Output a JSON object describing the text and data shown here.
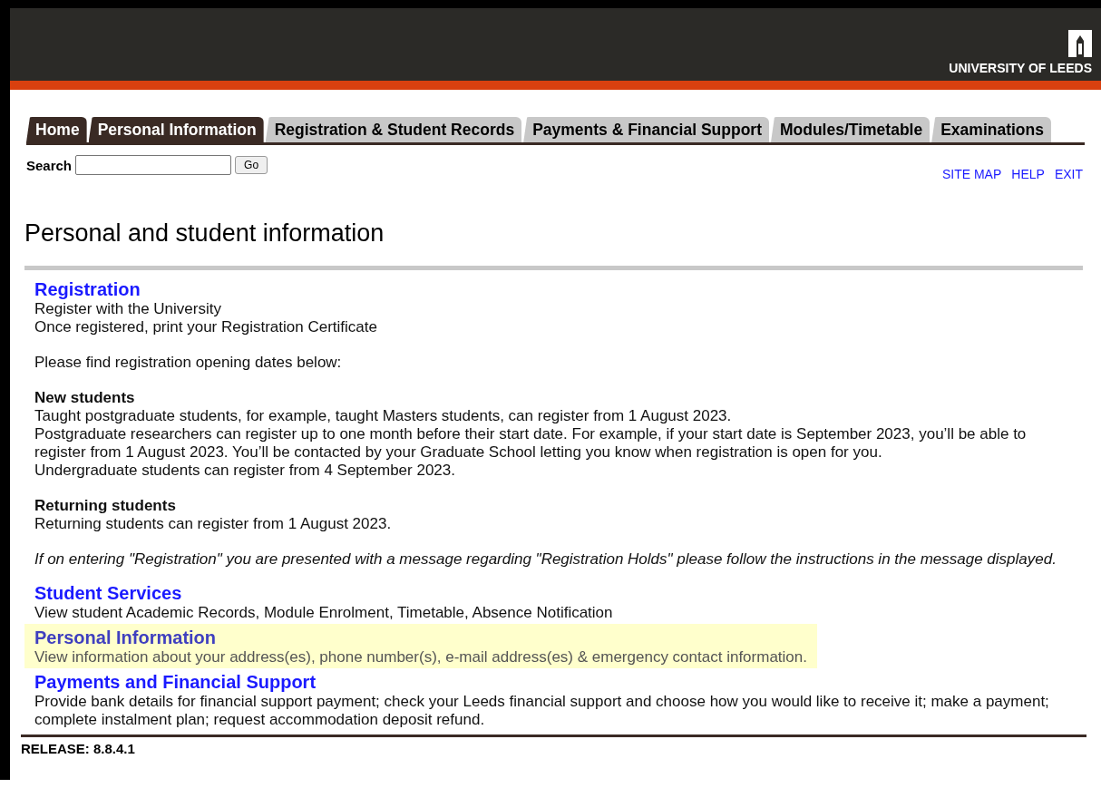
{
  "header": {
    "logo_text": "UNIVERSITY OF LEEDS"
  },
  "tabs": [
    {
      "label": "Home",
      "selected": true
    },
    {
      "label": "Personal Information",
      "selected": true
    },
    {
      "label": "Registration & Student Records",
      "selected": false
    },
    {
      "label": "Payments & Financial Support",
      "selected": false
    },
    {
      "label": "Modules/Timetable",
      "selected": false
    },
    {
      "label": "Examinations",
      "selected": false
    }
  ],
  "search": {
    "label": "Search",
    "button": "Go"
  },
  "top_links": [
    "SITE MAP",
    "HELP",
    "EXIT"
  ],
  "page_title": "Personal and student information",
  "sections": [
    {
      "title": "Registration",
      "highlighted": false,
      "blocks": [
        {
          "kind": "lines",
          "lines": [
            "Register with the University",
            "Once registered, print your Registration Certificate"
          ]
        },
        {
          "kind": "lines",
          "lines": [
            "Please find registration opening dates below:"
          ]
        },
        {
          "kind": "heading",
          "lines": [
            "New students"
          ]
        },
        {
          "kind": "lines",
          "lines": [
            "Taught postgraduate students, for example, taught Masters students, can register from 1 August 2023.",
            "Postgraduate researchers can register up to one month before their start date. For example, if your start date is September 2023, you’ll be able to register from 1 August 2023. You’ll be contacted by your Graduate School letting you know when registration is open for you.",
            "Undergraduate students can register from 4 September 2023."
          ]
        },
        {
          "kind": "heading",
          "lines": [
            "Returning students"
          ]
        },
        {
          "kind": "lines",
          "lines": [
            "Returning students can register from 1 August 2023."
          ]
        },
        {
          "kind": "note",
          "lines": [
            "If on entering \"Registration\" you are presented with a message regarding \"Registration Holds\" please follow the instructions in the message displayed."
          ]
        }
      ]
    },
    {
      "title": "Student Services",
      "highlighted": false,
      "blocks": [
        {
          "kind": "lines",
          "lines": [
            "View student Academic Records, Module Enrolment, Timetable, Absence Notification"
          ]
        }
      ]
    },
    {
      "title": "Personal Information",
      "highlighted": true,
      "blocks": [
        {
          "kind": "lines",
          "lines": [
            "View information about your address(es), phone number(s), e-mail address(es) & emergency contact information."
          ]
        }
      ]
    },
    {
      "title": "Payments and Financial Support",
      "highlighted": false,
      "blocks": [
        {
          "kind": "lines",
          "lines": [
            "Provide bank details for financial support payment; check your Leeds financial support and choose how you would like to receive it; make a payment; complete instalment plan; request accommodation deposit refund."
          ]
        }
      ]
    }
  ],
  "release": "RELEASE: 8.8.4.1"
}
